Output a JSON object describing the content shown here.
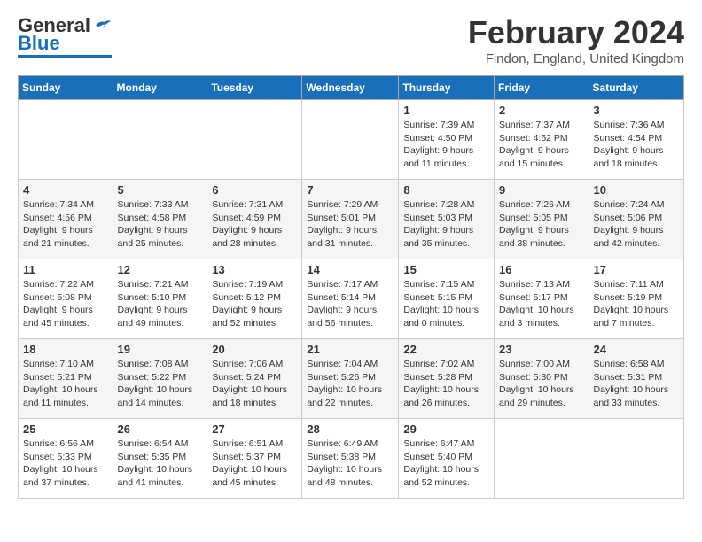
{
  "logo": {
    "general": "General",
    "blue": "Blue"
  },
  "title": "February 2024",
  "subtitle": "Findon, England, United Kingdom",
  "days_of_week": [
    "Sunday",
    "Monday",
    "Tuesday",
    "Wednesday",
    "Thursday",
    "Friday",
    "Saturday"
  ],
  "weeks": [
    [
      {
        "day": "",
        "info": ""
      },
      {
        "day": "",
        "info": ""
      },
      {
        "day": "",
        "info": ""
      },
      {
        "day": "",
        "info": ""
      },
      {
        "day": "1",
        "info": "Sunrise: 7:39 AM\nSunset: 4:50 PM\nDaylight: 9 hours\nand 11 minutes."
      },
      {
        "day": "2",
        "info": "Sunrise: 7:37 AM\nSunset: 4:52 PM\nDaylight: 9 hours\nand 15 minutes."
      },
      {
        "day": "3",
        "info": "Sunrise: 7:36 AM\nSunset: 4:54 PM\nDaylight: 9 hours\nand 18 minutes."
      }
    ],
    [
      {
        "day": "4",
        "info": "Sunrise: 7:34 AM\nSunset: 4:56 PM\nDaylight: 9 hours\nand 21 minutes."
      },
      {
        "day": "5",
        "info": "Sunrise: 7:33 AM\nSunset: 4:58 PM\nDaylight: 9 hours\nand 25 minutes."
      },
      {
        "day": "6",
        "info": "Sunrise: 7:31 AM\nSunset: 4:59 PM\nDaylight: 9 hours\nand 28 minutes."
      },
      {
        "day": "7",
        "info": "Sunrise: 7:29 AM\nSunset: 5:01 PM\nDaylight: 9 hours\nand 31 minutes."
      },
      {
        "day": "8",
        "info": "Sunrise: 7:28 AM\nSunset: 5:03 PM\nDaylight: 9 hours\nand 35 minutes."
      },
      {
        "day": "9",
        "info": "Sunrise: 7:26 AM\nSunset: 5:05 PM\nDaylight: 9 hours\nand 38 minutes."
      },
      {
        "day": "10",
        "info": "Sunrise: 7:24 AM\nSunset: 5:06 PM\nDaylight: 9 hours\nand 42 minutes."
      }
    ],
    [
      {
        "day": "11",
        "info": "Sunrise: 7:22 AM\nSunset: 5:08 PM\nDaylight: 9 hours\nand 45 minutes."
      },
      {
        "day": "12",
        "info": "Sunrise: 7:21 AM\nSunset: 5:10 PM\nDaylight: 9 hours\nand 49 minutes."
      },
      {
        "day": "13",
        "info": "Sunrise: 7:19 AM\nSunset: 5:12 PM\nDaylight: 9 hours\nand 52 minutes."
      },
      {
        "day": "14",
        "info": "Sunrise: 7:17 AM\nSunset: 5:14 PM\nDaylight: 9 hours\nand 56 minutes."
      },
      {
        "day": "15",
        "info": "Sunrise: 7:15 AM\nSunset: 5:15 PM\nDaylight: 10 hours\nand 0 minutes."
      },
      {
        "day": "16",
        "info": "Sunrise: 7:13 AM\nSunset: 5:17 PM\nDaylight: 10 hours\nand 3 minutes."
      },
      {
        "day": "17",
        "info": "Sunrise: 7:11 AM\nSunset: 5:19 PM\nDaylight: 10 hours\nand 7 minutes."
      }
    ],
    [
      {
        "day": "18",
        "info": "Sunrise: 7:10 AM\nSunset: 5:21 PM\nDaylight: 10 hours\nand 11 minutes."
      },
      {
        "day": "19",
        "info": "Sunrise: 7:08 AM\nSunset: 5:22 PM\nDaylight: 10 hours\nand 14 minutes."
      },
      {
        "day": "20",
        "info": "Sunrise: 7:06 AM\nSunset: 5:24 PM\nDaylight: 10 hours\nand 18 minutes."
      },
      {
        "day": "21",
        "info": "Sunrise: 7:04 AM\nSunset: 5:26 PM\nDaylight: 10 hours\nand 22 minutes."
      },
      {
        "day": "22",
        "info": "Sunrise: 7:02 AM\nSunset: 5:28 PM\nDaylight: 10 hours\nand 26 minutes."
      },
      {
        "day": "23",
        "info": "Sunrise: 7:00 AM\nSunset: 5:30 PM\nDaylight: 10 hours\nand 29 minutes."
      },
      {
        "day": "24",
        "info": "Sunrise: 6:58 AM\nSunset: 5:31 PM\nDaylight: 10 hours\nand 33 minutes."
      }
    ],
    [
      {
        "day": "25",
        "info": "Sunrise: 6:56 AM\nSunset: 5:33 PM\nDaylight: 10 hours\nand 37 minutes."
      },
      {
        "day": "26",
        "info": "Sunrise: 6:54 AM\nSunset: 5:35 PM\nDaylight: 10 hours\nand 41 minutes."
      },
      {
        "day": "27",
        "info": "Sunrise: 6:51 AM\nSunset: 5:37 PM\nDaylight: 10 hours\nand 45 minutes."
      },
      {
        "day": "28",
        "info": "Sunrise: 6:49 AM\nSunset: 5:38 PM\nDaylight: 10 hours\nand 48 minutes."
      },
      {
        "day": "29",
        "info": "Sunrise: 6:47 AM\nSunset: 5:40 PM\nDaylight: 10 hours\nand 52 minutes."
      },
      {
        "day": "",
        "info": ""
      },
      {
        "day": "",
        "info": ""
      }
    ]
  ]
}
